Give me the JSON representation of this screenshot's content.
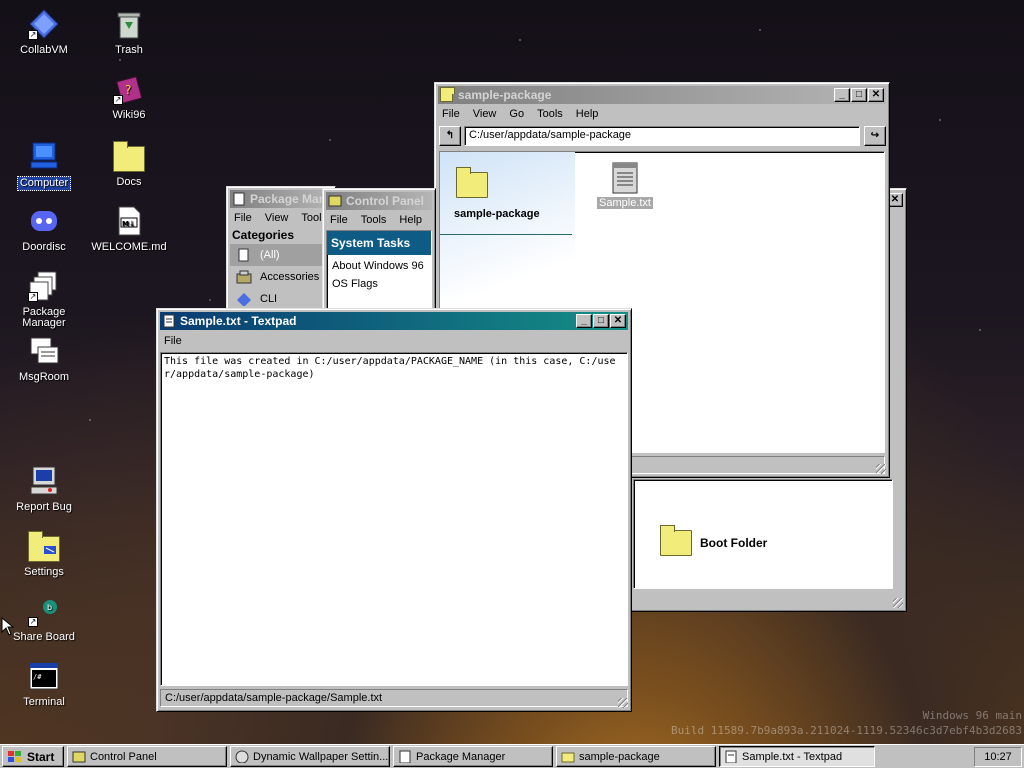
{
  "desktop": {
    "icons": [
      {
        "label": "CollabVM"
      },
      {
        "label": "Trash"
      },
      {
        "label": "Wiki96"
      },
      {
        "label": "Computer"
      },
      {
        "label": "Docs"
      },
      {
        "label": "Doordisc"
      },
      {
        "label": "WELCOME.md"
      },
      {
        "label": "Package Manager"
      },
      {
        "label": "MsgRoom"
      },
      {
        "label": "Report Bug"
      },
      {
        "label": "Settings"
      },
      {
        "label": "Share Board"
      },
      {
        "label": "Terminal"
      }
    ],
    "watermark_line1": "Windows 96 main",
    "watermark_line2": "Build 11589.7b9a893a.211024-1119.52346c3d7ebf4b3d2683"
  },
  "explorer": {
    "title": "sample-package",
    "menu": [
      "File",
      "View",
      "Go",
      "Tools",
      "Help"
    ],
    "address": "C:/user/appdata/sample-package",
    "up_icon": "up-arrow-icon",
    "go_icon": "go-arrow-icon",
    "sidebar_folder": "sample-package",
    "file_name": "Sample.txt"
  },
  "bg_window": {
    "item": "Boot Folder"
  },
  "package_manager": {
    "title": "Package Manager",
    "menu": [
      "File",
      "View",
      "Tools"
    ],
    "categories_label": "Categories",
    "categories": [
      "(All)",
      "Accessories",
      "CLI"
    ]
  },
  "control_panel": {
    "title": "Control Panel",
    "menu": [
      "File",
      "Tools",
      "Help"
    ],
    "system_tasks": "System Tasks",
    "tasks": [
      "About Windows 96",
      "OS Flags"
    ]
  },
  "textpad": {
    "title": "Sample.txt - Textpad",
    "menu": [
      "File"
    ],
    "content": "This file was created in C:/user/appdata/PACKAGE_NAME (in this case, C:/user/appdata/sample-package)",
    "status": "C:/user/appdata/sample-package/Sample.txt"
  },
  "taskbar": {
    "start": "Start",
    "buttons": [
      {
        "label": "Control Panel"
      },
      {
        "label": "Dynamic Wallpaper Settin..."
      },
      {
        "label": "Package Manager"
      },
      {
        "label": "sample-package"
      },
      {
        "label": "Sample.txt - Textpad"
      }
    ],
    "clock": "10:27"
  },
  "colors": {
    "title_active_start": "#0a3b73",
    "title_active_end": "#148f86",
    "selection": "#1f3f9e"
  }
}
